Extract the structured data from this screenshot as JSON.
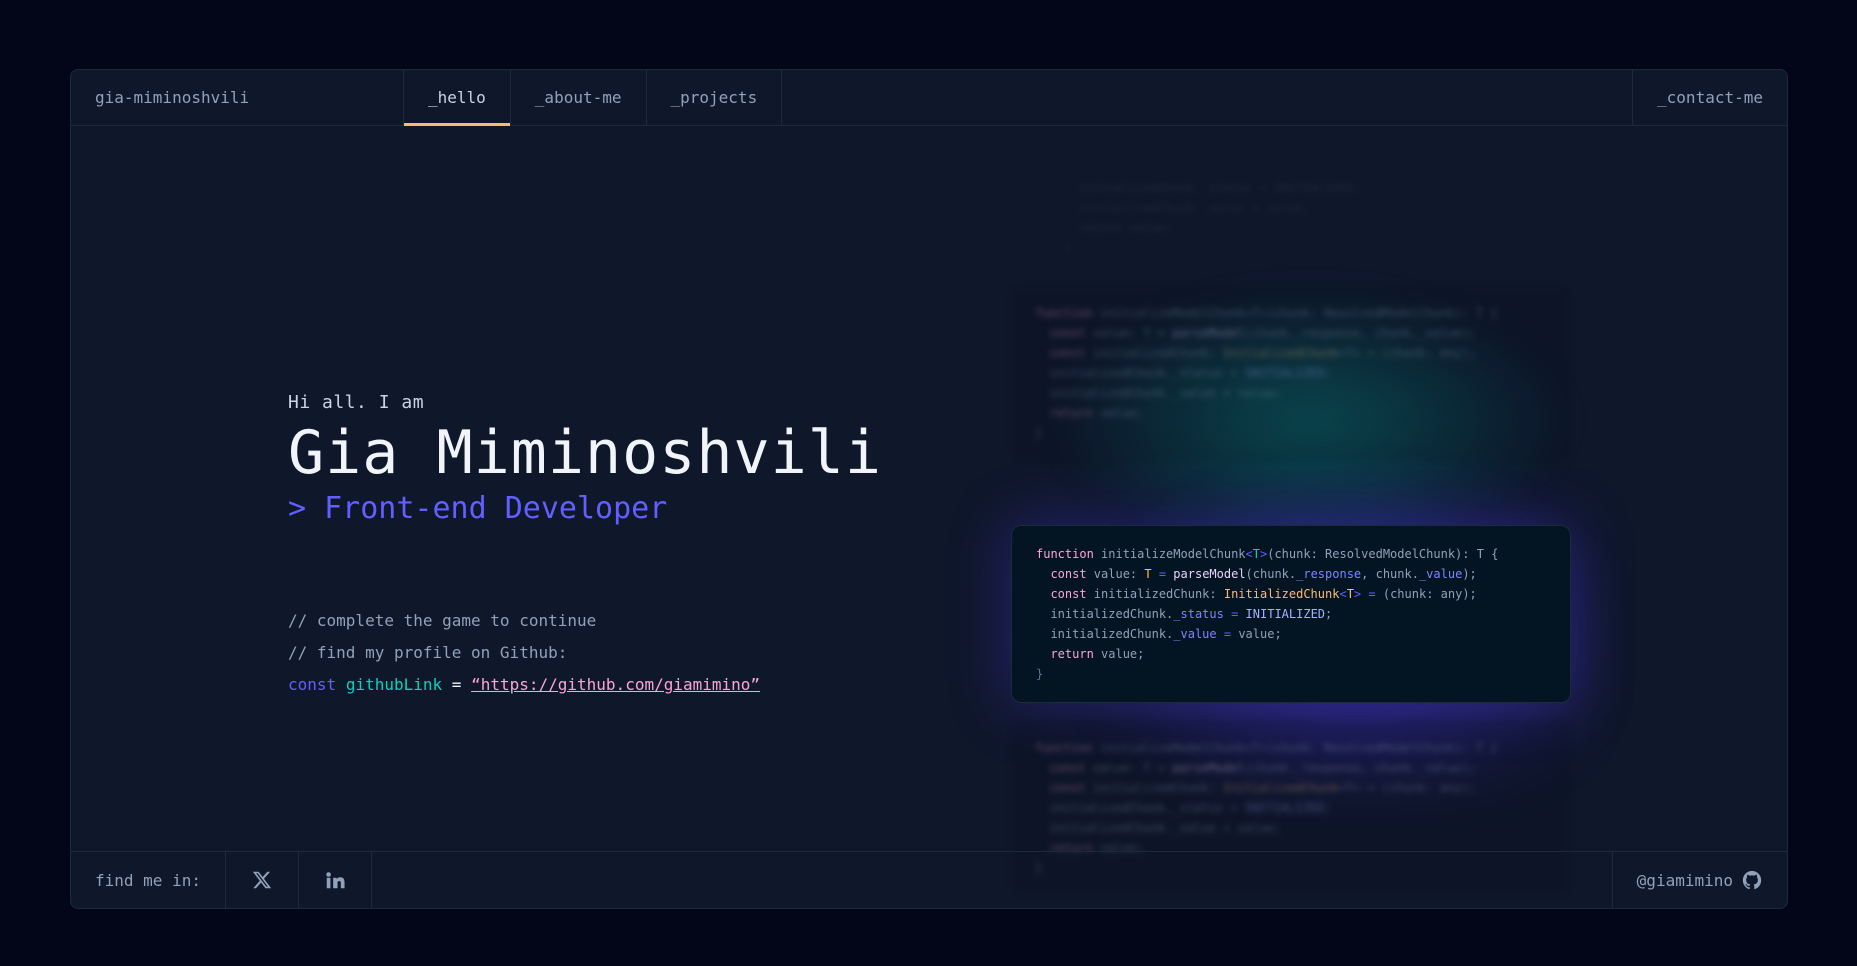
{
  "header": {
    "brand": "gia-miminoshvili",
    "tabs": [
      {
        "label": "_hello",
        "active": true
      },
      {
        "label": "_about-me",
        "active": false
      },
      {
        "label": "_projects",
        "active": false
      }
    ],
    "contact_label": "_contact-me"
  },
  "hero": {
    "greeting": "Hi all. I am",
    "name": "Gia Miminoshvili",
    "role": "> Front-end Developer",
    "comment_1": "// complete the game to continue",
    "comment_2": "// find my profile on Github:",
    "code_keyword": "const",
    "code_var": "githubLink",
    "code_eq": "=",
    "code_link": "“https://github.com/giamimino”"
  },
  "code_snippet": {
    "line1": {
      "kw": "function",
      "fn": " initializeModelChunk",
      "lt": "<",
      "t": "T",
      "gt": ">",
      "rest1": "(chunk: ResolvedModelChunk): T {"
    },
    "line2": {
      "indent": "  ",
      "kw": "const",
      "rest1": " value: ",
      "t": "T",
      "op": " = ",
      "call": "parseModel",
      "rest2": "(chunk.",
      "p1": "_response",
      "rest3": ", chunk.",
      "p2": "_value",
      "rest4": ");"
    },
    "line3": {
      "indent": "  ",
      "kw": "const",
      "rest1": " initializedChunk: ",
      "type": "InitializedChunk",
      "lt": "<",
      "t": "T",
      "gt": ">",
      "op": " = ",
      "rest2": "(chunk: any);"
    },
    "line4": {
      "indent": "  ",
      "rest1": "initializedChunk.",
      "p": "_status",
      "op": " = ",
      "c": "INITIALIZED",
      "rest2": ";"
    },
    "line5": {
      "indent": "  ",
      "rest1": "initializedChunk.",
      "p": "_value",
      "op": " = ",
      "rest2": "value;"
    },
    "line6": {
      "indent": "  ",
      "kw": "return",
      "rest1": " value;"
    },
    "line7": {
      "close": "}"
    }
  },
  "footer": {
    "find_me": "find me in:",
    "github_handle": "@giamimino"
  },
  "icons": {
    "x": "x-twitter-icon",
    "linkedin": "linkedin-icon",
    "github": "github-icon"
  },
  "colors": {
    "background": "#020618",
    "panel": "#0f172b",
    "border": "#1d293d",
    "accent_orange": "#fdba74",
    "accent_indigo": "#615fff",
    "accent_teal": "#00d5be",
    "link_pink": "#fda5d5"
  }
}
